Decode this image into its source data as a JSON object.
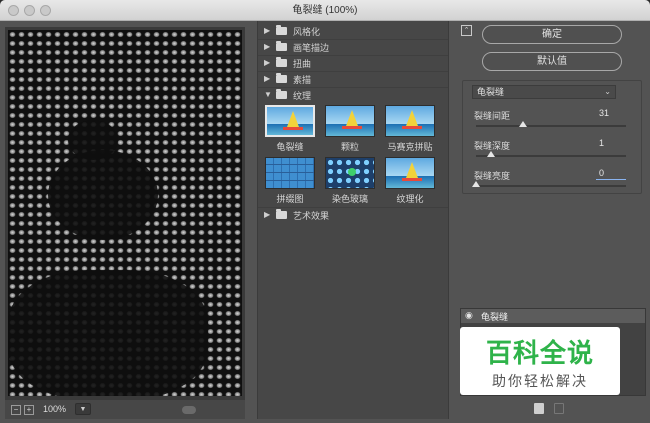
{
  "window": {
    "title": "龟裂缝 (100%)"
  },
  "preview": {
    "zoom": "100%"
  },
  "gallery": {
    "categories": [
      "风格化",
      "画笔描边",
      "扭曲",
      "素描",
      "纹理",
      "艺术效果"
    ],
    "thumbs": [
      "龟裂缝",
      "颗粒",
      "马赛克拼贴",
      "拼缀图",
      "染色玻璃",
      "纹理化"
    ]
  },
  "right": {
    "ok": "确定",
    "default": "默认值",
    "filter": "龟裂缝",
    "params": [
      {
        "label": "裂缝间距",
        "value": "31",
        "level": 0.31
      },
      {
        "label": "裂缝深度",
        "value": "1",
        "level": 0.1
      },
      {
        "label": "裂缝亮度",
        "value": "0",
        "level": 0.0
      }
    ],
    "layer": "龟裂缝"
  },
  "watermark": {
    "big": "百科全说",
    "small": "助你轻松解决"
  },
  "colors": {
    "watermark_green": "#2fb34a",
    "accent_blue": "#8ab4f0"
  }
}
